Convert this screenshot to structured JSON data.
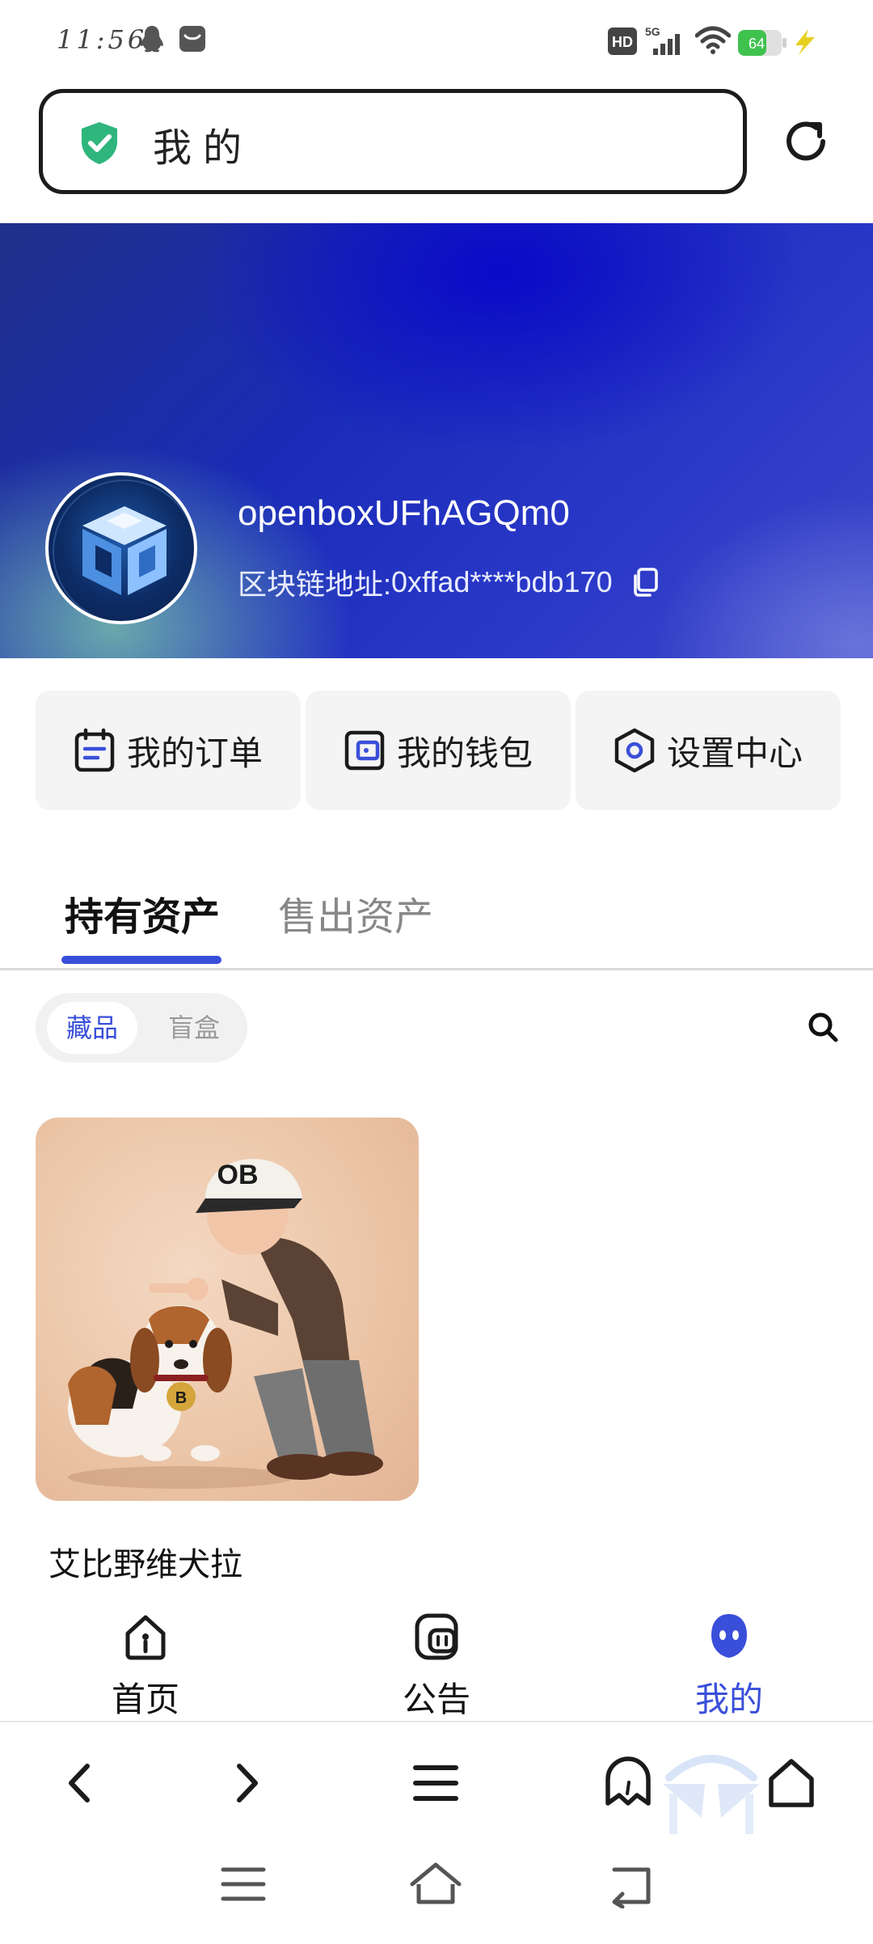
{
  "status_bar": {
    "time": "11:56",
    "battery_level": "64",
    "network": "5G",
    "hd_badge": "HD",
    "icons": [
      "qq-icon",
      "message-icon",
      "hd-icon",
      "signal-icon",
      "wifi-icon",
      "battery-icon",
      "charging-icon"
    ]
  },
  "address_bar": {
    "title": "我的",
    "icons": [
      "shield-check-icon",
      "reload-icon"
    ],
    "accent_color": "#2fb67c"
  },
  "profile": {
    "username": "openboxUFhAGQm0",
    "address_label": "区块链地址:",
    "address_value": "0xffad****bdb170"
  },
  "quick_actions": [
    {
      "label": "我的订单",
      "icon": "order-calendar-icon"
    },
    {
      "label": "我的钱包",
      "icon": "wallet-icon"
    },
    {
      "label": "设置中心",
      "icon": "settings-hexagon-icon"
    }
  ],
  "tabs": [
    {
      "label": "持有资产",
      "active": true
    },
    {
      "label": "售出资产",
      "active": false
    }
  ],
  "filter": {
    "options": [
      {
        "label": "藏品",
        "active": true
      },
      {
        "label": "盲盒",
        "active": false
      }
    ]
  },
  "assets": [
    {
      "title": "艾比野维犬拉",
      "cap_text": "OB",
      "tag_text": "B"
    }
  ],
  "bottom_nav": [
    {
      "label": "首页",
      "icon": "home-icon",
      "active": false
    },
    {
      "label": "公告",
      "icon": "announcement-icon",
      "active": false
    },
    {
      "label": "我的",
      "icon": "profile-ghost-icon",
      "active": true
    }
  ],
  "browser_toolbar": {
    "icons": [
      "back-arrow-icon",
      "forward-arrow-icon",
      "menu-icon",
      "bookmark-icon",
      "home-outline-icon"
    ]
  },
  "system_nav": {
    "icons": [
      "recent-apps-icon",
      "system-home-icon",
      "system-back-icon"
    ]
  },
  "colors": {
    "accent_blue": "#3a4fd9",
    "hero_blue": "#1a2cb8"
  }
}
